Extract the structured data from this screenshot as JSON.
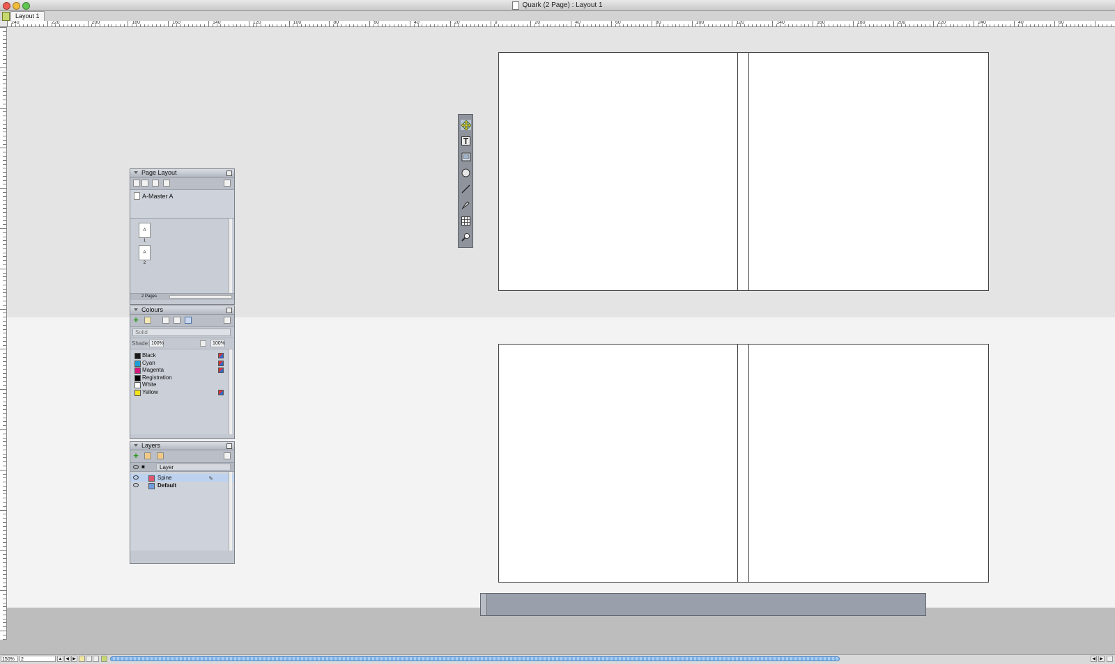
{
  "window": {
    "title": "Quark (2 Page) : Layout 1"
  },
  "tabs": [
    {
      "label": "Layout 1"
    }
  ],
  "ruler": {
    "h_labels": [
      "240",
      "220",
      "200",
      "180",
      "160",
      "140",
      "120",
      "100",
      "80",
      "60",
      "40",
      "20",
      "0",
      "20",
      "40",
      "60",
      "80",
      "100",
      "120",
      "140",
      "160",
      "180",
      "200",
      "220",
      "240",
      "40",
      "60"
    ]
  },
  "tools": [
    {
      "name": "item-tool"
    },
    {
      "name": "text-content-tool"
    },
    {
      "name": "picture-content-tool"
    },
    {
      "name": "oval-box-tool"
    },
    {
      "name": "line-tool"
    },
    {
      "name": "pen-tool"
    },
    {
      "name": "table-tool"
    },
    {
      "name": "zoom-tool"
    }
  ],
  "page_layout": {
    "title": "Page Layout",
    "master": "A-Master A",
    "pages": [
      {
        "label": "A",
        "number": "1"
      },
      {
        "label": "A",
        "number": "2"
      }
    ],
    "footer": "2 Pages"
  },
  "colours": {
    "title": "Colours",
    "fill_type": "Solid",
    "shade_label": "Shade:",
    "shade_value": "100%",
    "opacity_value": "100%",
    "items": [
      {
        "name": "Black",
        "color": "#1a1a1a",
        "process": true
      },
      {
        "name": "Cyan",
        "color": "#1e9fd8",
        "process": true
      },
      {
        "name": "Magenta",
        "color": "#d6177e",
        "process": true
      },
      {
        "name": "Registration",
        "color": "#000000",
        "process": false
      },
      {
        "name": "White",
        "color": "#ffffff",
        "process": false
      },
      {
        "name": "Yellow",
        "color": "#f4e21a",
        "process": true
      }
    ]
  },
  "layers": {
    "title": "Layers",
    "column_header": "Layer",
    "items": [
      {
        "name": "Spine",
        "color": "#e0566f",
        "selected": true,
        "bold": false
      },
      {
        "name": "Default",
        "color": "#6f9de0",
        "selected": false,
        "bold": true
      }
    ]
  },
  "status": {
    "zoom": "150%",
    "page": "2"
  }
}
